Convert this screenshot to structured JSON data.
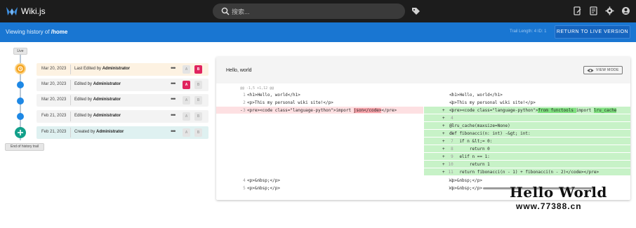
{
  "app": {
    "title": "Wiki.js"
  },
  "search": {
    "placeholder": "搜索..."
  },
  "subbar": {
    "viewing_prefix": "Viewing history of",
    "viewing_path": "/home",
    "trail_info": "Trail Length: 4   ID: 1",
    "return_label": "RETURN TO LIVE VERSION"
  },
  "trail": {
    "live_label": "Live",
    "end_label": "End of history trail",
    "items": [
      {
        "date": "Mar 20, 2023",
        "action": "Last Edited by",
        "user": "Administrator",
        "more": "•••",
        "a": "A",
        "b": "B",
        "a_active": false,
        "b_active": true
      },
      {
        "date": "Mar 20, 2023",
        "action": "Edited by",
        "user": "Administrator",
        "more": "•••",
        "a": "A",
        "b": "B",
        "a_active": true,
        "b_active": false
      },
      {
        "date": "Mar 20, 2023",
        "action": "Edited by",
        "user": "Administrator",
        "more": "•••",
        "a": "A",
        "b": "B",
        "a_active": false,
        "b_active": false
      },
      {
        "date": "Feb 21, 2023",
        "action": "Edited by",
        "user": "Administrator",
        "more": "•••",
        "a": "A",
        "b": "B",
        "a_active": false,
        "b_active": false
      },
      {
        "date": "Feb 21, 2023",
        "action": "Created by",
        "user": "Administrator",
        "more": "•••",
        "a": "A",
        "b": "B",
        "a_active": false,
        "b_active": false
      }
    ]
  },
  "diff": {
    "page_name": "Hello, world",
    "view_mode_label": "VIEW MODE",
    "hunk_header": "@@ -1,5 +1,12 @@",
    "left": [
      {
        "num": "1",
        "sign": "",
        "code": "<h1>Hello, world</h1>"
      },
      {
        "num": "2",
        "sign": "",
        "code": "<p>This my personal wiki site!</p>"
      },
      {
        "num": "3",
        "sign": "-",
        "code": "<pre><code class=\"language-python\">import ",
        "hl": "json</code>",
        "tail": "</pre>"
      },
      {
        "num": "4",
        "sign": "",
        "code": "<p>&nbsp;</p>"
      },
      {
        "num": "5",
        "sign": "",
        "code": "<p>&nbsp;</p>"
      }
    ],
    "right": [
      {
        "num": "1",
        "sign": "",
        "code": "<h1>Hello, world</h1>"
      },
      {
        "num": "2",
        "sign": "",
        "code": "<p>This my personal wiki site!</p>"
      },
      {
        "num": "3",
        "sign": "+",
        "code": "<pre><code class=\"language-python\">",
        "hl": "from functools ",
        "mid": "import ",
        "hl2": "lru_cache"
      },
      {
        "num": "4",
        "sign": "+",
        "code": ""
      },
      {
        "num": "5",
        "sign": "+",
        "code": "@lru_cache(maxsize=None)"
      },
      {
        "num": "6",
        "sign": "+",
        "code": "def fibonacci(n: int) -&gt; int:"
      },
      {
        "num": "7",
        "sign": "+",
        "code": "    if n &lt;= 0:"
      },
      {
        "num": "8",
        "sign": "+",
        "code": "        return 0"
      },
      {
        "num": "9",
        "sign": "+",
        "code": "    elif n == 1:"
      },
      {
        "num": "10",
        "sign": "+",
        "code": "        return 1"
      },
      {
        "num": "11",
        "sign": "+",
        "code": "    return fibonacci(n - 1) + fibonacci(n - 2)</code></pre>"
      },
      {
        "num": "12",
        "sign": "",
        "code": "<p>&nbsp;</p>"
      },
      {
        "num": "13",
        "sign": "",
        "code": "<p>&nbsp;</p>"
      }
    ]
  },
  "watermark": {
    "line1": "Hello World",
    "line2": "www.77388.cn"
  },
  "colors": {
    "topbar": "#1c1c1c",
    "subbar": "#1976d2",
    "accent_red": "#e0245e",
    "del_bg": "#fde0e2",
    "add_bg": "#c7f2c7"
  },
  "icons": [
    "wiki-logo-icon",
    "search-icon",
    "tag-icon",
    "new-page-icon",
    "page-actions-icon",
    "settings-icon",
    "account-icon",
    "eye-icon"
  ]
}
